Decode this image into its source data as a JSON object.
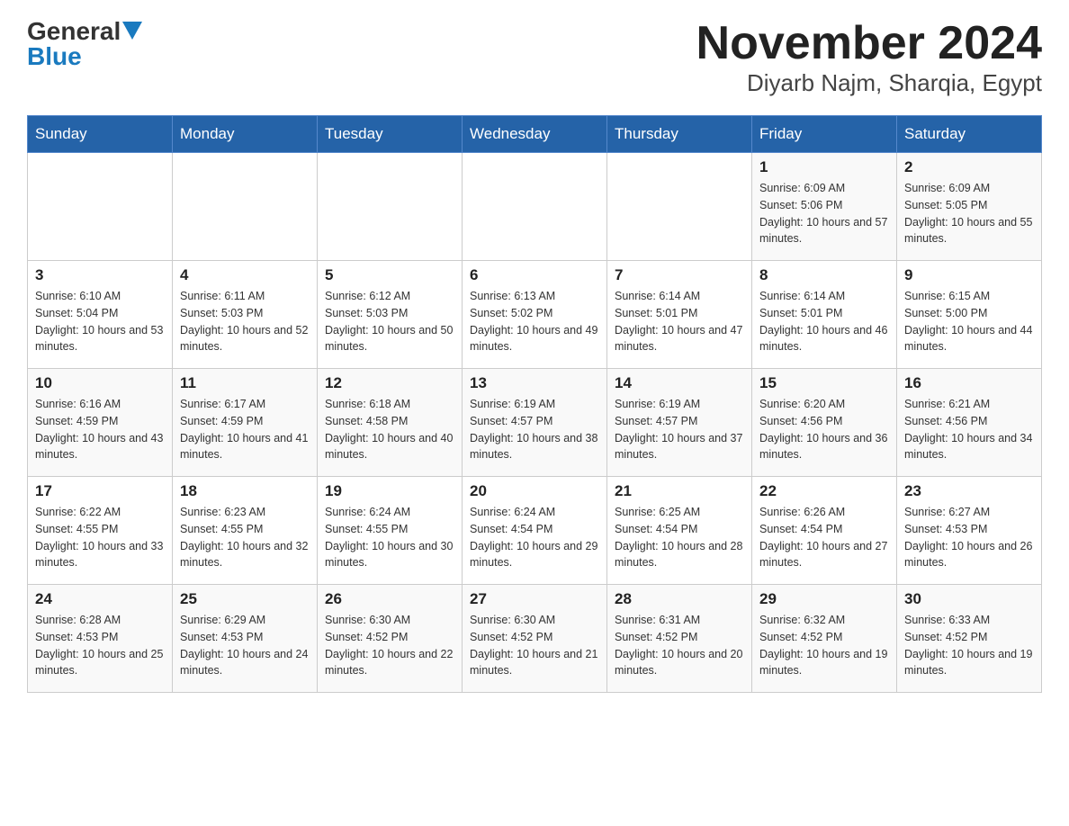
{
  "logo": {
    "general": "General",
    "blue": "Blue"
  },
  "title": "November 2024",
  "subtitle": "Diyarb Najm, Sharqia, Egypt",
  "days_of_week": [
    "Sunday",
    "Monday",
    "Tuesday",
    "Wednesday",
    "Thursday",
    "Friday",
    "Saturday"
  ],
  "weeks": [
    [
      {
        "day": "",
        "info": ""
      },
      {
        "day": "",
        "info": ""
      },
      {
        "day": "",
        "info": ""
      },
      {
        "day": "",
        "info": ""
      },
      {
        "day": "",
        "info": ""
      },
      {
        "day": "1",
        "info": "Sunrise: 6:09 AM\nSunset: 5:06 PM\nDaylight: 10 hours and 57 minutes."
      },
      {
        "day": "2",
        "info": "Sunrise: 6:09 AM\nSunset: 5:05 PM\nDaylight: 10 hours and 55 minutes."
      }
    ],
    [
      {
        "day": "3",
        "info": "Sunrise: 6:10 AM\nSunset: 5:04 PM\nDaylight: 10 hours and 53 minutes."
      },
      {
        "day": "4",
        "info": "Sunrise: 6:11 AM\nSunset: 5:03 PM\nDaylight: 10 hours and 52 minutes."
      },
      {
        "day": "5",
        "info": "Sunrise: 6:12 AM\nSunset: 5:03 PM\nDaylight: 10 hours and 50 minutes."
      },
      {
        "day": "6",
        "info": "Sunrise: 6:13 AM\nSunset: 5:02 PM\nDaylight: 10 hours and 49 minutes."
      },
      {
        "day": "7",
        "info": "Sunrise: 6:14 AM\nSunset: 5:01 PM\nDaylight: 10 hours and 47 minutes."
      },
      {
        "day": "8",
        "info": "Sunrise: 6:14 AM\nSunset: 5:01 PM\nDaylight: 10 hours and 46 minutes."
      },
      {
        "day": "9",
        "info": "Sunrise: 6:15 AM\nSunset: 5:00 PM\nDaylight: 10 hours and 44 minutes."
      }
    ],
    [
      {
        "day": "10",
        "info": "Sunrise: 6:16 AM\nSunset: 4:59 PM\nDaylight: 10 hours and 43 minutes."
      },
      {
        "day": "11",
        "info": "Sunrise: 6:17 AM\nSunset: 4:59 PM\nDaylight: 10 hours and 41 minutes."
      },
      {
        "day": "12",
        "info": "Sunrise: 6:18 AM\nSunset: 4:58 PM\nDaylight: 10 hours and 40 minutes."
      },
      {
        "day": "13",
        "info": "Sunrise: 6:19 AM\nSunset: 4:57 PM\nDaylight: 10 hours and 38 minutes."
      },
      {
        "day": "14",
        "info": "Sunrise: 6:19 AM\nSunset: 4:57 PM\nDaylight: 10 hours and 37 minutes."
      },
      {
        "day": "15",
        "info": "Sunrise: 6:20 AM\nSunset: 4:56 PM\nDaylight: 10 hours and 36 minutes."
      },
      {
        "day": "16",
        "info": "Sunrise: 6:21 AM\nSunset: 4:56 PM\nDaylight: 10 hours and 34 minutes."
      }
    ],
    [
      {
        "day": "17",
        "info": "Sunrise: 6:22 AM\nSunset: 4:55 PM\nDaylight: 10 hours and 33 minutes."
      },
      {
        "day": "18",
        "info": "Sunrise: 6:23 AM\nSunset: 4:55 PM\nDaylight: 10 hours and 32 minutes."
      },
      {
        "day": "19",
        "info": "Sunrise: 6:24 AM\nSunset: 4:55 PM\nDaylight: 10 hours and 30 minutes."
      },
      {
        "day": "20",
        "info": "Sunrise: 6:24 AM\nSunset: 4:54 PM\nDaylight: 10 hours and 29 minutes."
      },
      {
        "day": "21",
        "info": "Sunrise: 6:25 AM\nSunset: 4:54 PM\nDaylight: 10 hours and 28 minutes."
      },
      {
        "day": "22",
        "info": "Sunrise: 6:26 AM\nSunset: 4:54 PM\nDaylight: 10 hours and 27 minutes."
      },
      {
        "day": "23",
        "info": "Sunrise: 6:27 AM\nSunset: 4:53 PM\nDaylight: 10 hours and 26 minutes."
      }
    ],
    [
      {
        "day": "24",
        "info": "Sunrise: 6:28 AM\nSunset: 4:53 PM\nDaylight: 10 hours and 25 minutes."
      },
      {
        "day": "25",
        "info": "Sunrise: 6:29 AM\nSunset: 4:53 PM\nDaylight: 10 hours and 24 minutes."
      },
      {
        "day": "26",
        "info": "Sunrise: 6:30 AM\nSunset: 4:52 PM\nDaylight: 10 hours and 22 minutes."
      },
      {
        "day": "27",
        "info": "Sunrise: 6:30 AM\nSunset: 4:52 PM\nDaylight: 10 hours and 21 minutes."
      },
      {
        "day": "28",
        "info": "Sunrise: 6:31 AM\nSunset: 4:52 PM\nDaylight: 10 hours and 20 minutes."
      },
      {
        "day": "29",
        "info": "Sunrise: 6:32 AM\nSunset: 4:52 PM\nDaylight: 10 hours and 19 minutes."
      },
      {
        "day": "30",
        "info": "Sunrise: 6:33 AM\nSunset: 4:52 PM\nDaylight: 10 hours and 19 minutes."
      }
    ]
  ]
}
